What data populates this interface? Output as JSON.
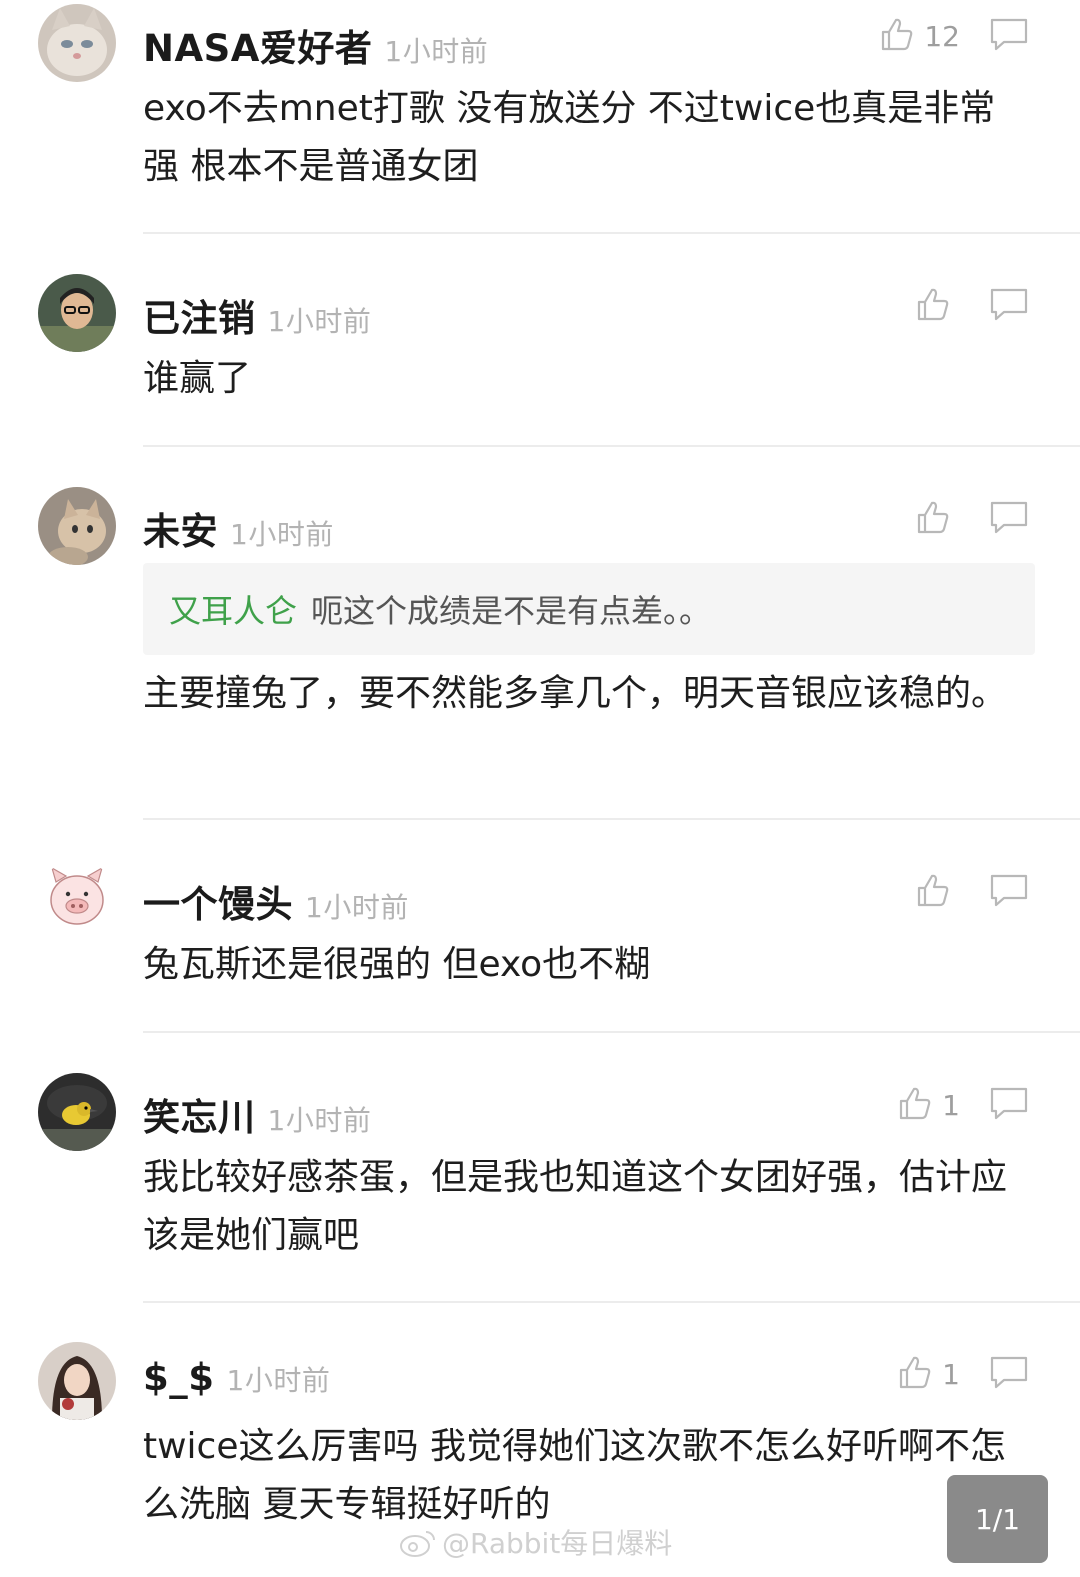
{
  "comments": [
    {
      "user": "NASA爱好者",
      "time": "1小时前",
      "likes": "12",
      "avatar": "cat-avatar",
      "text": "exo不去mnet打歌 没有放送分 不过twice也真是非常强 根本不是普通女团",
      "quote": null
    },
    {
      "user": "已注销",
      "time": "1小时前",
      "likes": "",
      "avatar": "person-avatar",
      "text": "谁赢了",
      "quote": null
    },
    {
      "user": "未安",
      "time": "1小时前",
      "likes": "",
      "avatar": "kitten-avatar",
      "text": "主要撞兔了，要不然能多拿几个，明天音银应该稳的。",
      "quote": {
        "author": "又耳人仑",
        "text": "呃这个成绩是不是有点差。。"
      }
    },
    {
      "user": "一个馒头",
      "time": "1小时前",
      "likes": "",
      "avatar": "pig-avatar",
      "text": "兔瓦斯还是很强的 但exo也不糊",
      "quote": null
    },
    {
      "user": "笑忘川",
      "time": "1小时前",
      "likes": "1",
      "avatar": "bird-avatar",
      "text": "我比较好感茶蛋，但是我也知道这个女团好强，估计应该是她们赢吧",
      "quote": null
    },
    {
      "user": "$_$",
      "time": "1小时前",
      "likes": "1",
      "avatar": "girl-avatar",
      "text": "twice这么厉害吗  我觉得她们这次歌不怎么好听啊不怎么洗脑 夏天专辑挺好听的",
      "quote": null
    }
  ],
  "pager": "1/1",
  "watermark": "@Rabbit每日爆料",
  "colors": {
    "quote_author": "#3fa14a",
    "time": "#b3b3b3",
    "divider": "#ececec"
  }
}
